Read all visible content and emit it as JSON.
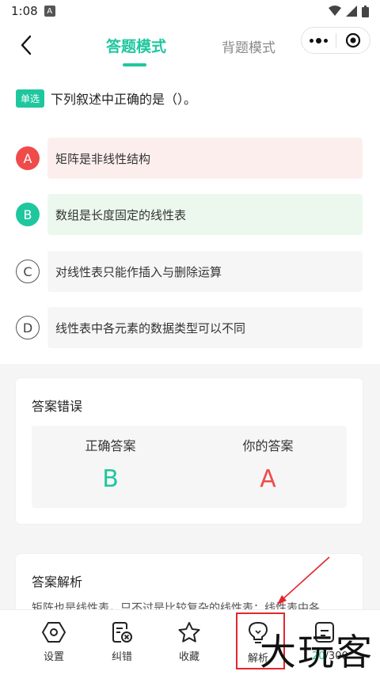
{
  "status": {
    "time": "1:08",
    "app_badge": "A"
  },
  "nav": {
    "tab_active": "答题模式",
    "tab_inactive": "背题模式"
  },
  "question": {
    "type": "单选",
    "text": "下列叙述中正确的是（）。"
  },
  "options": [
    {
      "letter": "A",
      "text": "矩阵是非线性结构",
      "state": "wrong"
    },
    {
      "letter": "B",
      "text": "数组是长度固定的线性表",
      "state": "correct"
    },
    {
      "letter": "C",
      "text": "对线性表只能作插入与删除运算",
      "state": "plain"
    },
    {
      "letter": "D",
      "text": "线性表中各元素的数据类型可以不同",
      "state": "plain"
    }
  ],
  "result": {
    "title": "答案错误",
    "correct_label": "正确答案",
    "correct_value": "B",
    "yours_label": "你的答案",
    "yours_value": "A"
  },
  "explanation": {
    "title": "答案解析",
    "text": "矩阵也是线性表，只不过是比较复杂的线性表；线性表中各"
  },
  "toolbar": {
    "settings": "设置",
    "report": "纠错",
    "favorite": "收藏",
    "analysis": "解析",
    "counter_current": "20",
    "counter_total": "/300"
  },
  "watermark": "大玩客",
  "colors": {
    "accent": "#1fc79e",
    "error": "#f04b4b",
    "highlight_box": "#e3262c"
  }
}
